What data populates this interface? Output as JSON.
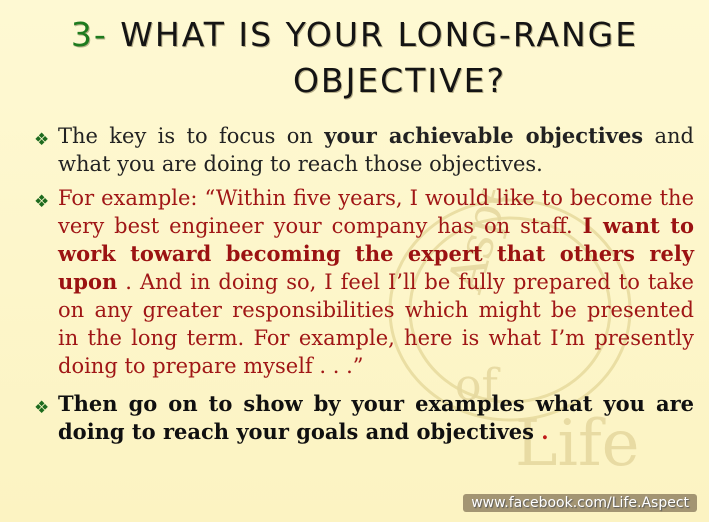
{
  "title": {
    "number": "3-",
    "line1": "What is your long-range",
    "line2": "objective?"
  },
  "bullets": [
    {
      "text_a": "The key is to focus on",
      "text_bold": "your achievable objectives",
      "text_b": "and what you are doing to reach those objectives."
    },
    {
      "text_a": "For example: “Within five years, I would like to become the very best engineer your company has on staff.",
      "text_bold": "I want to work toward becoming the expert that others rely upon",
      "text_b": ". And in doing so, I feel I’ll be fully prepared to take on any greater responsibilities which might be presented in the long term. For example, here is what I’m presently doing to prepare myself . . .”"
    },
    {
      "text_a": "Then go on to show by your examples what you are doing to reach your goals and objectives",
      "text_dot": " ."
    }
  ],
  "watermark": {
    "word1": "Aspects",
    "word2": "of",
    "word3": "Life"
  },
  "footer": "www.facebook.com/Life.Aspect",
  "colors": {
    "background": "#fdf6c8",
    "title_number": "#1e7b1e",
    "red_text": "#a01616",
    "bullet_icon": "#1e6b1e"
  },
  "icons": {
    "bullet": "diamond-bullet-icon"
  }
}
